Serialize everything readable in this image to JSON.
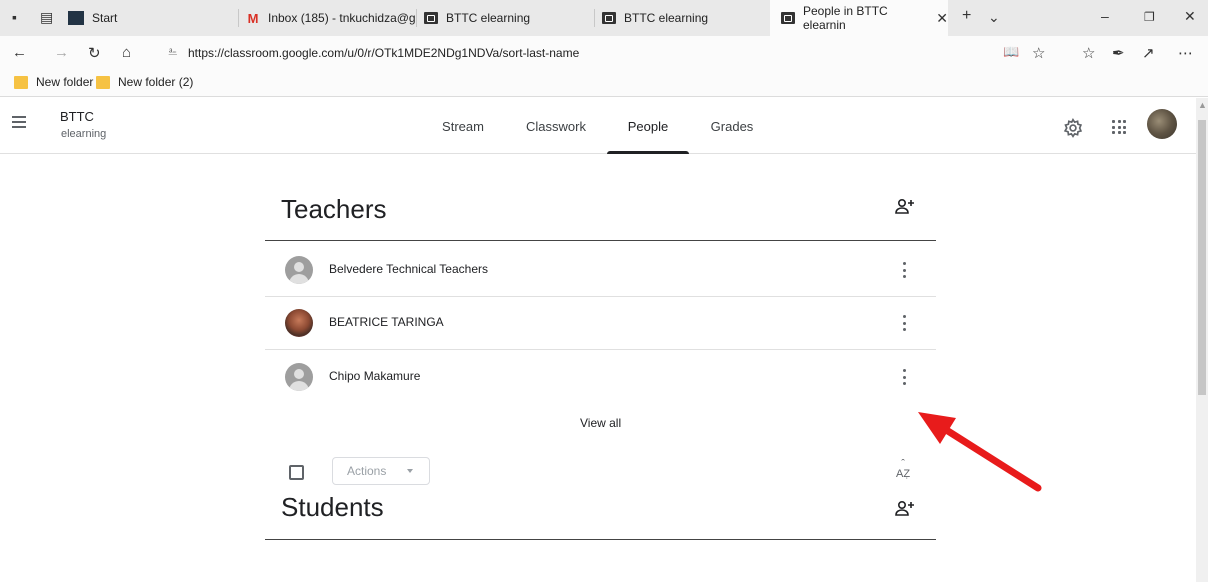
{
  "browser": {
    "strip_icons": [
      "set-aside-tabs-icon",
      "tab-previews-icon"
    ],
    "tabs": [
      {
        "title": "Start",
        "favicon": "start-icon",
        "active": false
      },
      {
        "title": "Inbox (185) - tnkuchidza@g",
        "favicon": "gmail-icon",
        "active": false
      },
      {
        "title": "BTTC elearning",
        "favicon": "classroom-icon",
        "active": false
      },
      {
        "title": "BTTC elearning",
        "favicon": "classroom-icon",
        "active": false
      },
      {
        "title": "People in BTTC elearnin",
        "favicon": "classroom-icon",
        "active": true
      }
    ],
    "url": "https://classroom.google.com/u/0/r/OTk1MDE2NDg1NDVa/sort-last-name",
    "favorites": [
      "New folder",
      "New folder (2)"
    ]
  },
  "app": {
    "class_name": "BTTC",
    "class_section": "elearning",
    "nav_tabs": [
      "Stream",
      "Classwork",
      "People",
      "Grades"
    ],
    "active_tab": "People"
  },
  "teachers": {
    "title": "Teachers",
    "people": [
      {
        "name": "Belvedere Technical Teachers",
        "avatar": "default-avatar"
      },
      {
        "name": "BEATRICE TARINGA",
        "avatar": "photo-avatar"
      },
      {
        "name": "Chipo Makamure",
        "avatar": "default-avatar"
      }
    ],
    "view_all": "View all"
  },
  "students": {
    "title": "Students",
    "actions_label": "Actions",
    "sort_icon": "sort-az-icon"
  },
  "colors": {
    "annotation_arrow": "#e81b1b",
    "tabstrip_bg": "#e9e9e9",
    "active_tab_underline": "#202124"
  }
}
